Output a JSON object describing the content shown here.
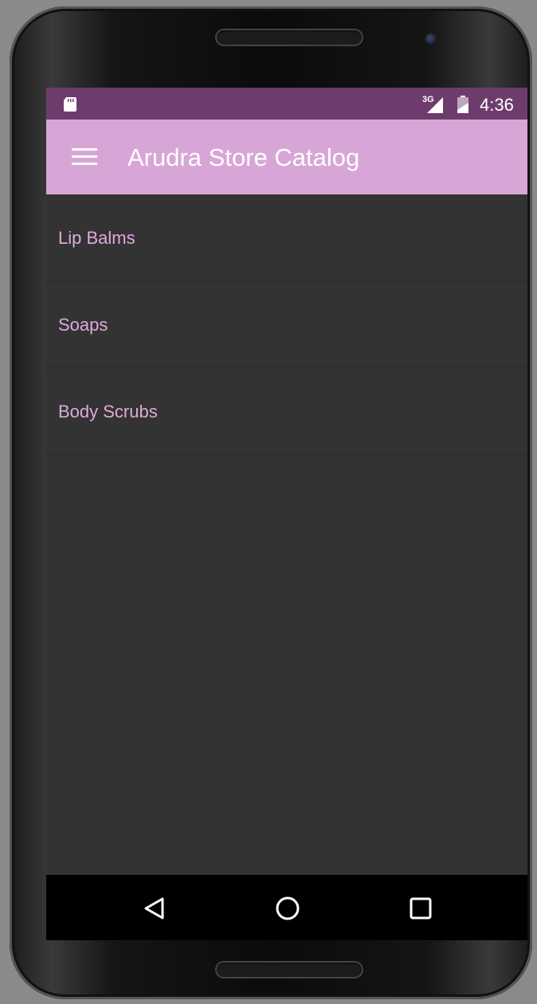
{
  "status_bar": {
    "network_type": "3G",
    "time": "4:36",
    "icons": [
      "sd-card-icon",
      "signal-icon",
      "battery-icon"
    ]
  },
  "app_bar": {
    "title": "Arudra Store Catalog",
    "menu_icon": "hamburger-menu-icon",
    "background_color": "#d8a6d6"
  },
  "categories": [
    {
      "label": "Lip Balms"
    },
    {
      "label": "Soaps"
    },
    {
      "label": "Body Scrubs"
    }
  ],
  "navigation_bar": {
    "buttons": [
      "back-icon",
      "home-icon",
      "recents-icon"
    ]
  },
  "colors": {
    "status_bar": "#6d3c6c",
    "accent_text": "#e0a9dc",
    "background": "#333333"
  }
}
